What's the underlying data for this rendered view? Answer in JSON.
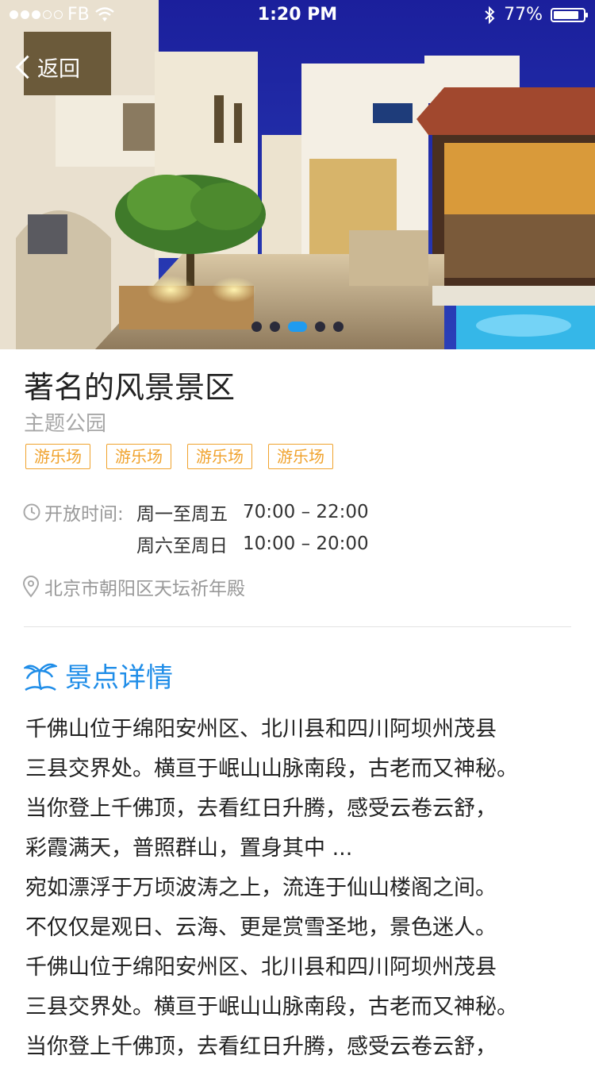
{
  "status_bar": {
    "carrier": "FB",
    "time": "1:20 PM",
    "battery_percent": "77%",
    "battery_level": 0.77,
    "icons": [
      "wifi-icon",
      "bluetooth-icon",
      "battery-icon"
    ]
  },
  "nav": {
    "back_label": "返回"
  },
  "hero": {
    "pager": {
      "count": 5,
      "active_index": 2
    },
    "accent_color": "#1f9bf0"
  },
  "place": {
    "name": "著名的风景景区",
    "category": "主题公园",
    "tags": [
      "游乐场",
      "游乐场",
      "游乐场",
      "游乐场"
    ],
    "tag_color": "#f0a22c"
  },
  "hours": {
    "label": "开放时间:",
    "rows": [
      {
        "days": "周一至周五",
        "time": "70:00 – 22:00"
      },
      {
        "days": "周六至周日",
        "time": "10:00 – 20:00"
      }
    ]
  },
  "address": "北京市朝阳区天坛祈年殿",
  "details": {
    "heading": "景点详情",
    "heading_color": "#1f8de8",
    "text": "千佛山位于绵阳安州区、北川县和四川阿坝州茂县\n三县交界处。横亘于岷山山脉南段，古老而又神秘。\n当你登上千佛顶，去看红日升腾，感受云卷云舒，\n彩霞满天，普照群山，置身其中 ...\n宛如漂浮于万顷波涛之上，流连于仙山楼阁之间。\n不仅仅是观日、云海、更是赏雪圣地，景色迷人。\n千佛山位于绵阳安州区、北川县和四川阿坝州茂县\n三县交界处。横亘于岷山山脉南段，古老而又神秘。\n当你登上千佛顶，去看红日升腾，感受云卷云舒，"
  }
}
